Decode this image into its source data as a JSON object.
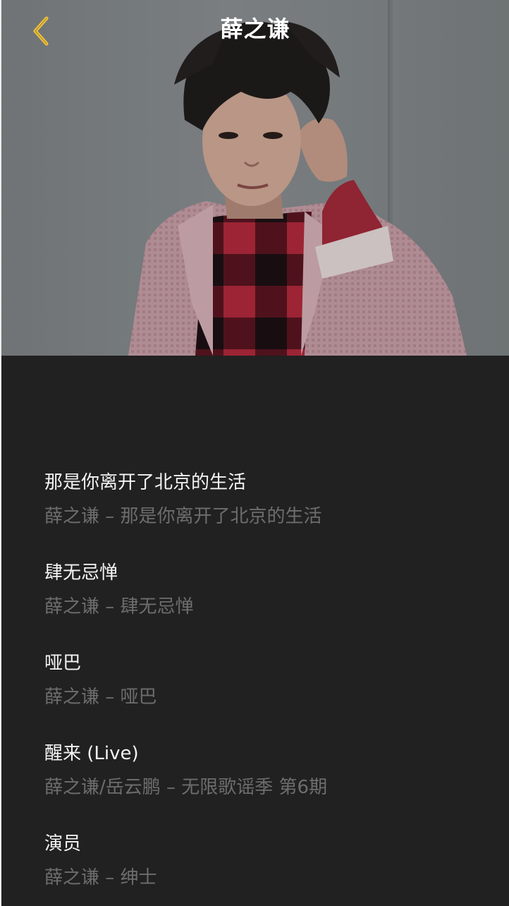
{
  "header": {
    "title": "薛之谦",
    "back_icon": "chevron-left-icon"
  },
  "colors": {
    "accent": "#f2c33a",
    "background": "#212121",
    "title_text": "#f4f4f4",
    "subtitle_text": "#6d6d6d"
  },
  "songs": [
    {
      "title": "那是你离开了北京的生活",
      "subtitle": "薛之谦 – 那是你离开了北京的生活"
    },
    {
      "title": "肆无忌惮",
      "subtitle": "薛之谦 – 肆无忌惮"
    },
    {
      "title": "哑巴",
      "subtitle": "薛之谦 – 哑巴"
    },
    {
      "title": "醒来 (Live)",
      "subtitle": "薛之谦/岳云鹏 – 无限歌谣季 第6期"
    },
    {
      "title": "演员",
      "subtitle": "薛之谦 – 绅士"
    }
  ]
}
